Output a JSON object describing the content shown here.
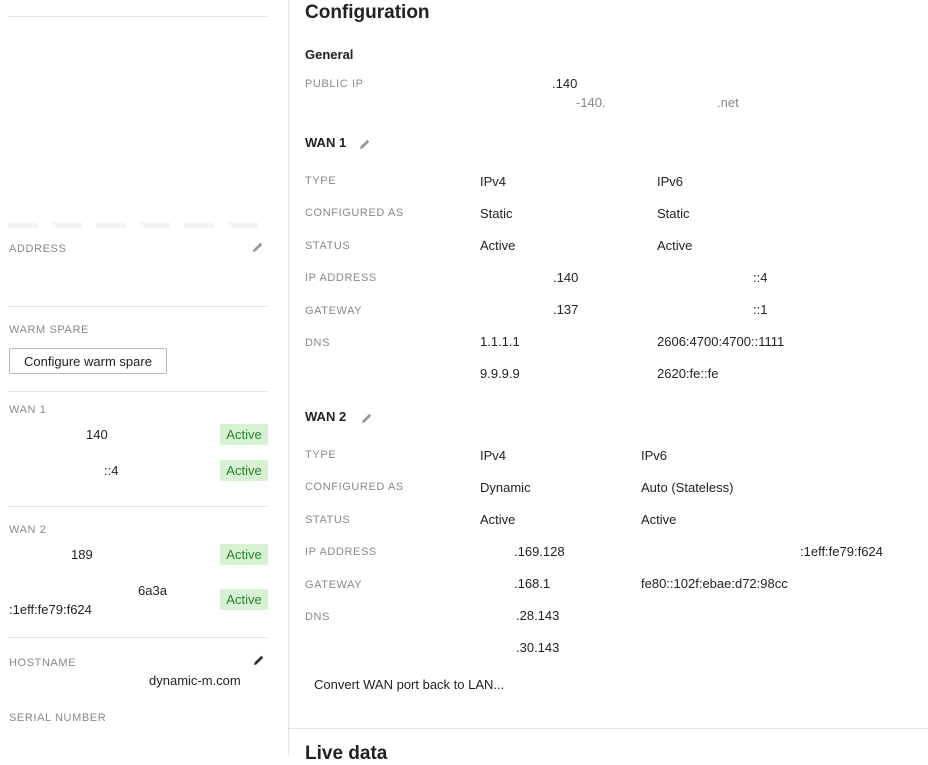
{
  "sidebar": {
    "address_label": "ADDRESS",
    "warm_spare": {
      "label": "WARM SPARE",
      "button": "Configure warm spare"
    },
    "wan1": {
      "label": "WAN 1",
      "rows": [
        {
          "value": "140",
          "status": "Active"
        },
        {
          "value": "::4",
          "status": "Active"
        }
      ]
    },
    "wan2": {
      "label": "WAN 2",
      "rows": [
        {
          "value": "189",
          "status": "Active"
        },
        {
          "value": "6a3a",
          "value2": ":1eff:fe79:f624",
          "status": "Active"
        }
      ]
    },
    "hostname": {
      "label": "HOSTNAME",
      "value": "dynamic-m.com"
    },
    "serial_label": "SERIAL NUMBER"
  },
  "main": {
    "title": "Configuration",
    "general": {
      "title": "General",
      "public_ip_label": "PUBLIC IP",
      "public_ip": ".140",
      "public_host_a": "-140.",
      "public_host_b": ".net"
    },
    "wan1": {
      "title": "WAN 1",
      "labels": {
        "type": "TYPE",
        "configured": "CONFIGURED AS",
        "status": "STATUS",
        "ip": "IP ADDRESS",
        "gateway": "GATEWAY",
        "dns": "DNS"
      },
      "ipv4": {
        "type": "IPv4",
        "configured": "Static",
        "status": "Active",
        "ip": ".140",
        "gateway": ".137",
        "dns1": "1.1.1.1",
        "dns2": "9.9.9.9"
      },
      "ipv6": {
        "type": "IPv6",
        "configured": "Static",
        "status": "Active",
        "ip": "::4",
        "gateway": "::1",
        "dns1": "2606:4700:4700::1111",
        "dns2": "2620:fe::fe"
      }
    },
    "wan2": {
      "title": "WAN 2",
      "labels": {
        "type": "TYPE",
        "configured": "CONFIGURED AS",
        "status": "STATUS",
        "ip": "IP ADDRESS",
        "gateway": "GATEWAY",
        "dns": "DNS"
      },
      "ipv4": {
        "type": "IPv4",
        "configured": "Dynamic",
        "status": "Active",
        "ip": ".169.128",
        "gateway": ".168.1",
        "dns1": ".28.143",
        "dns2": ".30.143"
      },
      "ipv6": {
        "type": "IPv6",
        "configured": "Auto (Stateless)",
        "status": "Active",
        "ip": ":1eff:fe79:f624",
        "gateway": "fe80::102f:ebae:d72:98cc"
      }
    },
    "convert_link": "Convert WAN port back to LAN...",
    "next_section_title": "Live data"
  },
  "colors": {
    "active_bg": "#d7f2d3",
    "active_text": "#2e7d32",
    "label": "#888888",
    "divider": "#e3e3e3"
  },
  "icons": {
    "edit": "pencil-icon"
  }
}
